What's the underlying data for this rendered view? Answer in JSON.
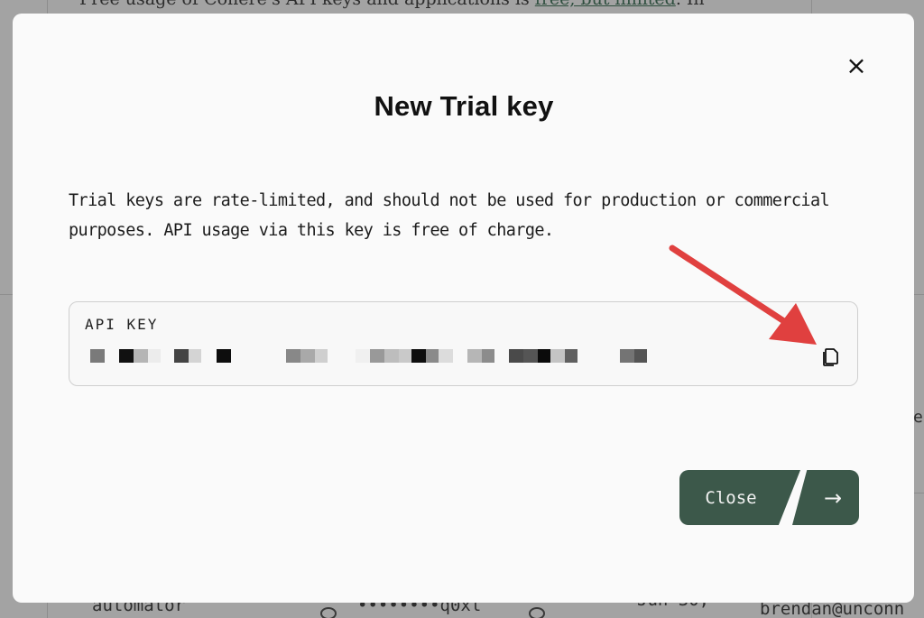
{
  "background": {
    "top_text_before": "Free usage of Cohere's API keys and applications is ",
    "top_text_link": "free, but limited",
    "top_text_after": ". In",
    "side_text": "e",
    "row": {
      "name": "automator",
      "masked_key": "••••••••q0xl",
      "date": "Jun 30,",
      "owner": "brendan@unconn"
    }
  },
  "modal": {
    "title": "New Trial key",
    "close_icon": "×",
    "description": "Trial keys are rate-limited, and should not be used for production or commercial purposes. API usage via this key is free of charge.",
    "api_key_label": "API KEY",
    "copy_icon": "copy-icon",
    "close_button_label": "Close",
    "arrow_button_icon": "→",
    "annotation_color": "#e0403f",
    "accent_color": "#3c584a"
  }
}
